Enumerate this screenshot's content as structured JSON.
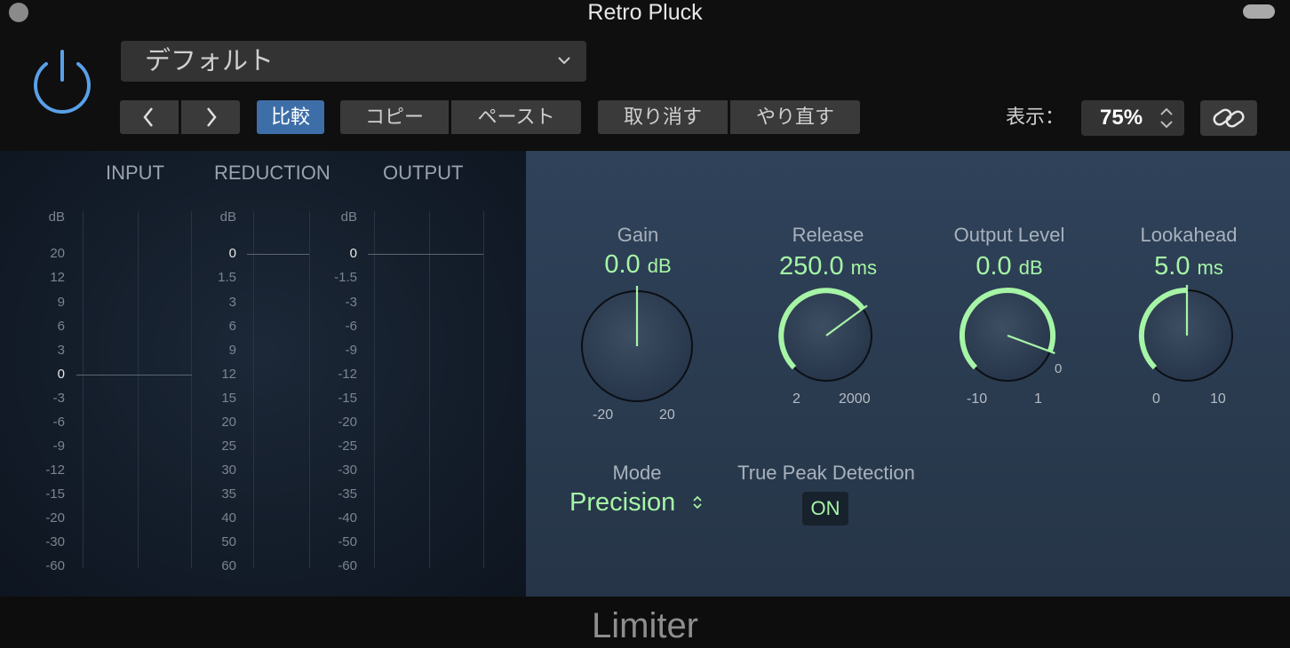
{
  "window": {
    "title": "Retro Pluck"
  },
  "toolbar": {
    "preset": "デフォルト",
    "prev_icon": "chevron-left-icon",
    "next_icon": "chevron-right-icon",
    "compare": "比較",
    "copy": "コピー",
    "paste": "ペースト",
    "undo": "取り消す",
    "redo": "やり直す",
    "view_label": "表示：",
    "zoom": "75%"
  },
  "meters": {
    "headers": [
      "INPUT",
      "REDUCTION",
      "OUTPUT"
    ],
    "unit": "dB",
    "input_scale": [
      "20",
      "12",
      "9",
      "6",
      "3",
      "0",
      "-3",
      "-6",
      "-9",
      "-12",
      "-15",
      "-20",
      "-30",
      "-60"
    ],
    "reduction_scale": [
      "0",
      "1.5",
      "3",
      "6",
      "9",
      "12",
      "15",
      "20",
      "25",
      "30",
      "35",
      "40",
      "50",
      "60"
    ],
    "output_scale": [
      "0",
      "-1.5",
      "-3",
      "-6",
      "-9",
      "-12",
      "-15",
      "-20",
      "-25",
      "-30",
      "-35",
      "-40",
      "-50",
      "-60"
    ]
  },
  "params": {
    "gain": {
      "label": "Gain",
      "value": "0.0",
      "unit": "dB",
      "min": "-20",
      "max": "20",
      "numeric": 0.0
    },
    "release": {
      "label": "Release",
      "value": "250.0",
      "unit": "ms",
      "min": "2",
      "max": "2000",
      "numeric": 250.0
    },
    "output_level": {
      "label": "Output Level",
      "value": "0.0",
      "unit": "dB",
      "min": "-10",
      "max": "1",
      "extra": "0",
      "numeric": 0.0
    },
    "lookahead": {
      "label": "Lookahead",
      "value": "5.0",
      "unit": "ms",
      "min": "0",
      "max": "10",
      "numeric": 5.0
    },
    "mode": {
      "label": "Mode",
      "value": "Precision"
    },
    "true_peak": {
      "label": "True Peak Detection",
      "value": "ON"
    }
  },
  "colors": {
    "accent": "#a6f5a6",
    "compare": "#3d6ea8",
    "panel": "#2f425a"
  },
  "footer": {
    "plugin_name": "Limiter"
  }
}
